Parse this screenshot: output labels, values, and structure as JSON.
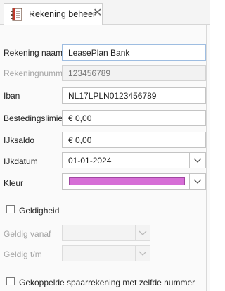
{
  "tab": {
    "icon": "ledger-book-icon",
    "title": "Rekening beheer",
    "close_glyph": "✕"
  },
  "form": {
    "name_label": "Rekening naam",
    "name_value": "LeasePlan Bank",
    "number_label": "Rekeningnummer",
    "number_placeholder": "123456789",
    "iban_label": "Iban",
    "iban_value": "NL17LPLN0123456789",
    "limit_label": "Bestedingslimiet",
    "limit_value": "€ 0,00",
    "calibration_label": "IJksaldo",
    "calibration_value": "€ 0,00",
    "calibration_date_label": "IJkdatum",
    "calibration_date_value": "01-01-2024",
    "color_label": "Kleur",
    "color_value": "#d66ed6",
    "validity_label": "Geldigheid",
    "validity_checked": false,
    "valid_from_label": "Geldig vanaf",
    "valid_to_label": "Geldig t/m",
    "linked_savings_label": "Gekoppelde spaarrekening met zelfde nummer",
    "linked_savings_checked": false
  }
}
